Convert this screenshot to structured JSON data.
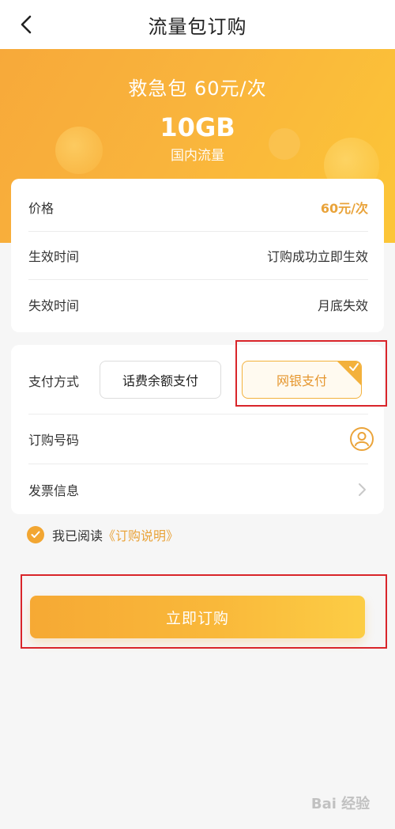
{
  "header": {
    "title": "流量包订购"
  },
  "hero": {
    "title": "救急包  60元/次",
    "size": "10GB",
    "subtitle": "国内流量"
  },
  "details": [
    {
      "label": "价格",
      "value": "60元/次"
    },
    {
      "label": "生效时间",
      "value": "订购成功立即生效"
    },
    {
      "label": "失效时间",
      "value": "月底失效"
    }
  ],
  "payment": {
    "label": "支付方式",
    "options": [
      "话费余额支付",
      "网银支付"
    ],
    "selected": "网银支付"
  },
  "order": {
    "label": "订购号码",
    "value": ""
  },
  "invoice": {
    "label": "发票信息"
  },
  "agreement": {
    "text": "我已阅读",
    "link": "《订购说明》",
    "checked": true
  },
  "cta": {
    "label": "立即订购"
  },
  "watermark": {
    "text": "Bai 经验"
  },
  "colors": {
    "accent": "#f3b13c",
    "accent_text": "#e9a33a",
    "highlight": "#d9252a"
  }
}
